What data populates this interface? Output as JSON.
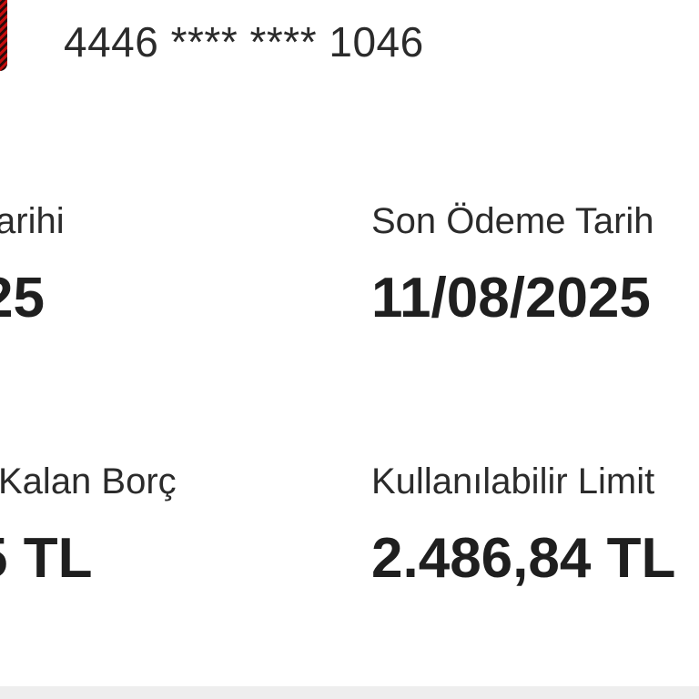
{
  "card": {
    "number_masked": "4446 **** **** 1046"
  },
  "summary": {
    "statement_date_label": "arihi",
    "statement_date_value": "25",
    "due_date_label": "Son Ödeme Tarih",
    "due_date_value": "11/08/2025",
    "remaining_debt_label": "Kalan Borç",
    "remaining_debt_value": "5 TL",
    "available_limit_label": "Kullanılabilir Limit",
    "available_limit_value": "2.486,84 TL"
  },
  "colors": {
    "text_primary": "#1f1f1f",
    "text_secondary": "#2b2b2b",
    "card_red": "#c40d0d"
  }
}
